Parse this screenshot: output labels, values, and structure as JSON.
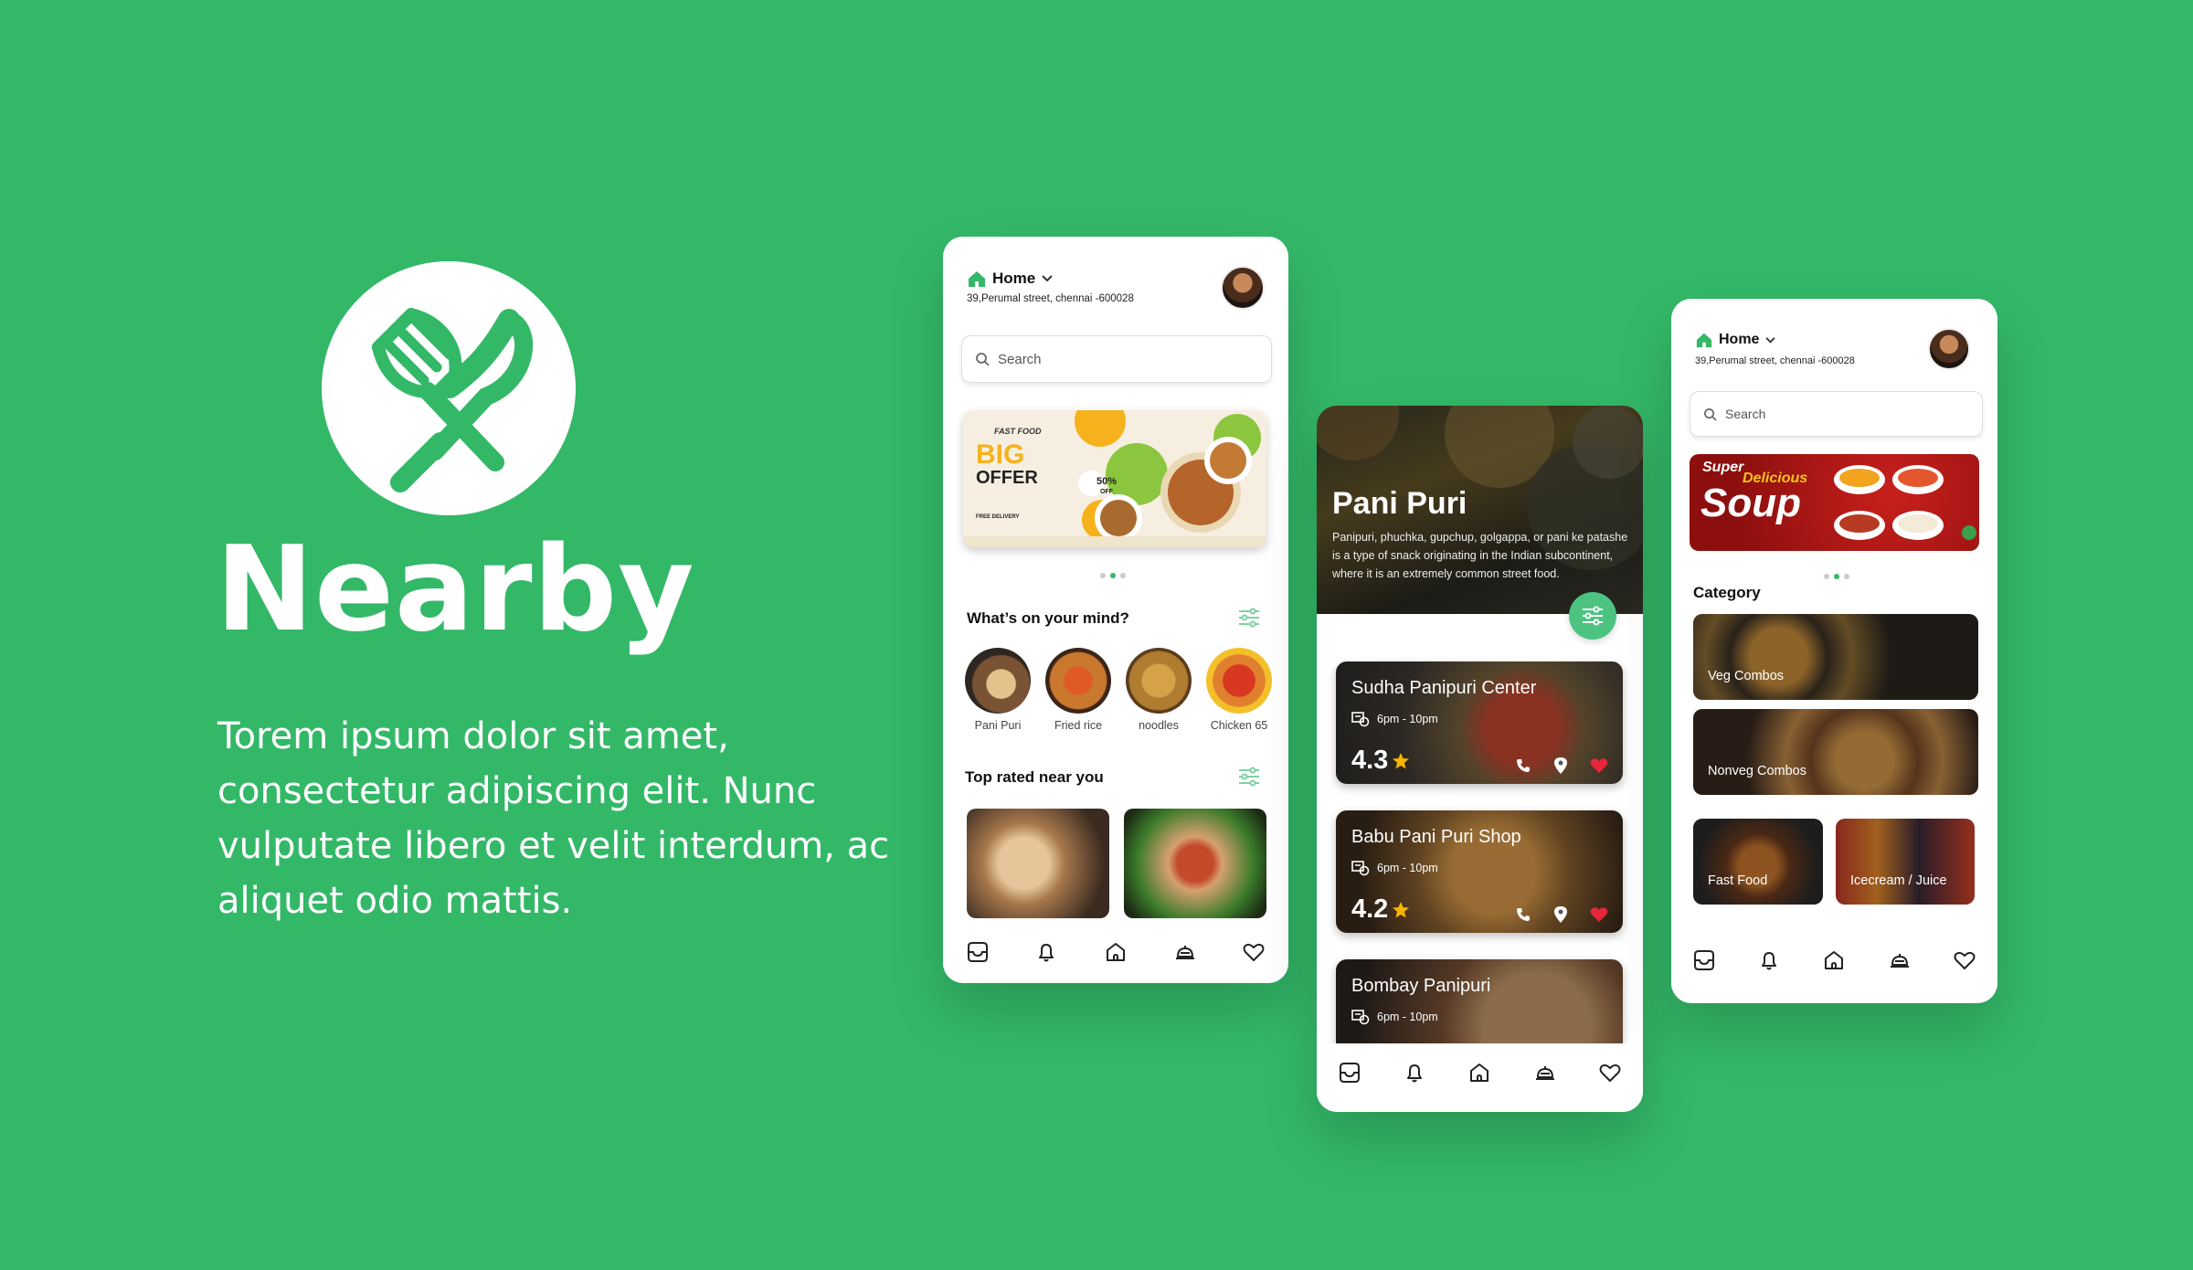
{
  "brand": {
    "name": "Nearby",
    "tagline": "Torem ipsum dolor sit amet, consectetur adipiscing elit. Nunc vulputate libero et velit interdum, ac aliquet odio mattis."
  },
  "colors": {
    "primary": "#33b868",
    "accent": "#4dc381",
    "heart": "#e8263a",
    "star": "#f5b400"
  },
  "header": {
    "location_label": "Home",
    "address": "39,Perumal street, chennai -600028"
  },
  "search": {
    "placeholder": "Search"
  },
  "home_screen": {
    "banner": {
      "brand": "FAST FOOD",
      "headline_1": "BIG",
      "headline_2": "OFFER",
      "discount": "50%",
      "discount_suffix": "OFF",
      "note": "FREE DELIVERY"
    },
    "mind_title": "What’s on your mind?",
    "categories": [
      {
        "label": "Pani Puri"
      },
      {
        "label": "Fried rice"
      },
      {
        "label": "noodles"
      },
      {
        "label": "Chicken 65"
      }
    ],
    "top_rated_title": "Top rated near you"
  },
  "detail_screen": {
    "title": "Pani Puri",
    "description": "Panipuri, phuchka, gupchup, golgappa, or pani ke patashe is a type of snack originating in the Indian subcontinent, where it is an extremely common street food.",
    "shops": [
      {
        "name": "Sudha Panipuri Center",
        "hours": "6pm - 10pm",
        "rating": "4.3",
        "favorited": true
      },
      {
        "name": "Babu Pani Puri Shop",
        "hours": "6pm - 10pm",
        "rating": "4.2",
        "favorited": true
      },
      {
        "name": "Bombay Panipuri",
        "hours": "6pm - 10pm"
      }
    ]
  },
  "category_screen": {
    "banner": {
      "line_1": "Super",
      "line_2": "Delicious",
      "line_3": "Soup"
    },
    "title": "Category",
    "categories": [
      {
        "label": "Veg Combos"
      },
      {
        "label": "Nonveg Combos"
      },
      {
        "label": "Fast Food"
      },
      {
        "label": "Icecream / Juice"
      }
    ]
  },
  "nav": {
    "items": [
      {
        "icon": "tray-icon"
      },
      {
        "icon": "bell-icon"
      },
      {
        "icon": "home-icon"
      },
      {
        "icon": "cloche-icon"
      },
      {
        "icon": "heart-icon"
      }
    ]
  }
}
